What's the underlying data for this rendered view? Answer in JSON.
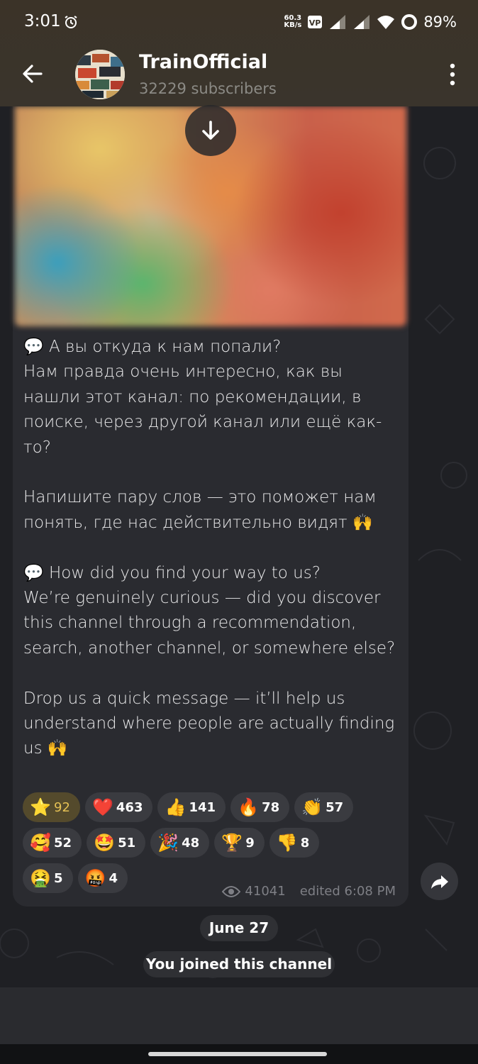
{
  "status_bar": {
    "time": "3:01",
    "net_speed_top": "60.3",
    "net_speed_unit": "KB/s",
    "battery": "89%"
  },
  "header": {
    "title": "TrainOfficial",
    "subtitle": "32229 subscribers",
    "back_icon": "arrow-left-icon",
    "menu_icon": "more-vertical-icon"
  },
  "message": {
    "paragraphs": [
      "💬 А вы откуда к нам попали?\nНам правда очень интересно, как вы нашли этот канал: по рекомендации, в поиске, через другой канал или ещё как-то?",
      "Напишите пару слов — это поможет нам понять, где нас действительно видят 🙌",
      "💬 How did you find your way to us?\nWe’re genuinely curious — did you discover this channel through a recommendation, search, another channel, or somewhere else?",
      "Drop us a quick message — it’ll help us understand where people are actually finding us 🙌"
    ],
    "reactions": [
      {
        "emoji": "⭐",
        "count": "92",
        "kind": "star"
      },
      {
        "emoji": "❤️",
        "count": "463"
      },
      {
        "emoji": "👍",
        "count": "141"
      },
      {
        "emoji": "🔥",
        "count": "78"
      },
      {
        "emoji": "👏",
        "count": "57"
      },
      {
        "emoji": "🥰",
        "count": "52"
      },
      {
        "emoji": "🤩",
        "count": "51"
      },
      {
        "emoji": "🎉",
        "count": "48"
      },
      {
        "emoji": "🏆",
        "count": "9"
      },
      {
        "emoji": "👎",
        "count": "8"
      },
      {
        "emoji": "🤮",
        "count": "5"
      },
      {
        "emoji": "🤬",
        "count": "4"
      }
    ],
    "views": "41041",
    "edited_time": "edited 6:08 PM"
  },
  "service": {
    "date": "June 27",
    "joined": "You joined this channel"
  },
  "colors": {
    "header_bg": "#3b3328",
    "bubble_bg": "#2a2b30",
    "star_reaction_bg": "#544a2c",
    "star_reaction_text": "#e4c054"
  }
}
